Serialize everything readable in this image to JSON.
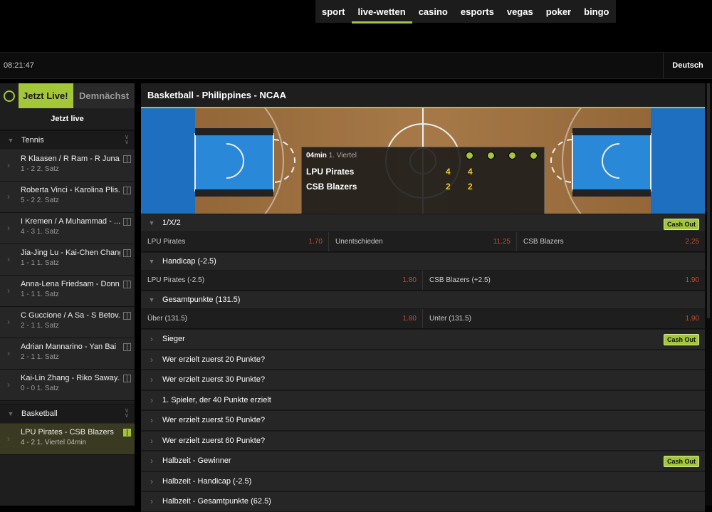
{
  "nav": [
    "sport",
    "live-wetten",
    "casino",
    "esports",
    "vegas",
    "poker",
    "bingo"
  ],
  "clock": "08:21:47",
  "language": "Deutsch",
  "sidebar": {
    "tab_live": "Jetzt Live!",
    "tab_soon": "Demnächst",
    "live_heading": "Jetzt live",
    "cat_tennis": "Tennis",
    "cat_basketball": "Basketball",
    "tennis_events": [
      {
        "title": "R Klaasen / R Ram - R Juna...",
        "sub": "1 - 2  2. Satz"
      },
      {
        "title": "Roberta Vinci - Karolina Plis...",
        "sub": "5 - 2  2. Satz"
      },
      {
        "title": "I Kremen / A Muhammad - ...",
        "sub": "4 - 3  1. Satz"
      },
      {
        "title": "Jia-Jing Lu - Kai-Chen Chang",
        "sub": "1 - 1  1. Satz"
      },
      {
        "title": "Anna-Lena Friedsam - Donn...",
        "sub": "1 - 1  1. Satz"
      },
      {
        "title": "C Guccione / A Sa - S Betov...",
        "sub": "2 - 1  1. Satz"
      },
      {
        "title": "Adrian Mannarino - Yan Bai",
        "sub": "2 - 1  1. Satz"
      },
      {
        "title": "Kai-Lin Zhang - Riko Saway...",
        "sub": "0 - 0  1. Satz"
      }
    ],
    "basketball_event": {
      "title": "LPU Pirates - CSB Blazers",
      "sub": "4 - 2  1. Viertel  04min"
    }
  },
  "main": {
    "title": "Basketball - Philippines - NCAA",
    "score": {
      "time": "04min",
      "period": "1. Viertel",
      "team1": "LPU Pirates",
      "team1_a": "4",
      "team1_b": "4",
      "team2": "CSB Blazers",
      "team2_a": "2",
      "team2_b": "2"
    },
    "cashout_label": "Cash Out",
    "m1x2": {
      "title": "1/X/2",
      "o1": "LPU Pirates",
      "v1": "1.70",
      "o2": "Unentschieden",
      "v2": "11.25",
      "o3": "CSB Blazers",
      "v3": "2.25"
    },
    "handicap": {
      "title": "Handicap (-2.5)",
      "o1": "LPU Pirates (-2.5)",
      "v1": "1.80",
      "o2": "CSB Blazers (+2.5)",
      "v2": "1.90"
    },
    "total": {
      "title": "Gesamtpunkte (131.5)",
      "o1": "Über (131.5)",
      "v1": "1.80",
      "o2": "Unter (131.5)",
      "v2": "1.90"
    },
    "markets": [
      "Sieger",
      "Wer erzielt zuerst 20 Punkte?",
      "Wer erzielt zuerst 30 Punkte?",
      "1. Spieler, der 40 Punkte erzielt",
      "Wer erzielt zuerst 50 Punkte?",
      "Wer erzielt zuerst 60 Punkte?",
      "Halbzeit - Gewinner",
      "Halbzeit - Handicap (-2.5)",
      "Halbzeit - Gesamtpunkte (62.5)"
    ]
  },
  "colors": {
    "accent": "#a4c639",
    "odds": "#c74b2a",
    "score": "#f2c832"
  }
}
